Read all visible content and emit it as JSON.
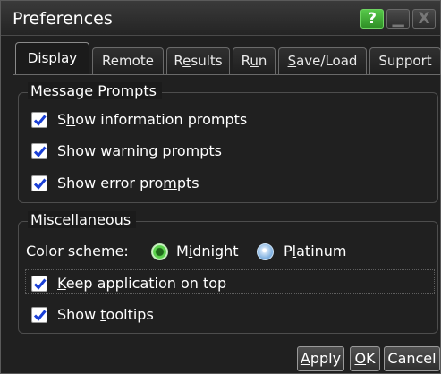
{
  "window": {
    "title": "Preferences"
  },
  "titlebar_buttons": {
    "help": "?",
    "minimize": "",
    "close": "X"
  },
  "tabs": [
    {
      "pre": "",
      "key": "D",
      "post": "isplay",
      "active": true
    },
    {
      "pre": "Remote",
      "key": "",
      "post": "",
      "active": false
    },
    {
      "pre": "R",
      "key": "e",
      "post": "sults",
      "active": false
    },
    {
      "pre": "R",
      "key": "u",
      "post": "n",
      "active": false
    },
    {
      "pre": "",
      "key": "S",
      "post": "ave/Load",
      "active": false
    },
    {
      "pre": "Support",
      "key": "",
      "post": "",
      "active": false
    }
  ],
  "message_prompts": {
    "title": "Message Prompts",
    "items": [
      {
        "pre": "S",
        "key": "h",
        "post": "ow information prompts",
        "checked": true
      },
      {
        "pre": "Sho",
        "key": "w",
        "post": " warning prompts",
        "checked": true
      },
      {
        "pre": "Show error pro",
        "key": "m",
        "post": "pts",
        "checked": true
      }
    ]
  },
  "misc": {
    "title": "Miscellaneous",
    "color_scheme_label": "Color scheme:",
    "options": [
      {
        "pre": "M",
        "key": "i",
        "post": "dnight",
        "selected": true
      },
      {
        "pre": "P",
        "key": "l",
        "post": "atinum",
        "selected": false
      }
    ],
    "items": [
      {
        "pre": "",
        "key": "K",
        "post": "eep application on top",
        "checked": true
      },
      {
        "pre": "Show ",
        "key": "t",
        "post": "ooltips",
        "checked": true
      }
    ]
  },
  "buttons": {
    "apply": {
      "pre": "",
      "key": "A",
      "post": "pply"
    },
    "ok": {
      "pre": "",
      "key": "O",
      "post": "K"
    },
    "cancel": "Cancel"
  },
  "colors": {
    "accent_green": "#4bc23c",
    "check_blue": "#1a3fd6",
    "background": "#1b1b1b"
  }
}
